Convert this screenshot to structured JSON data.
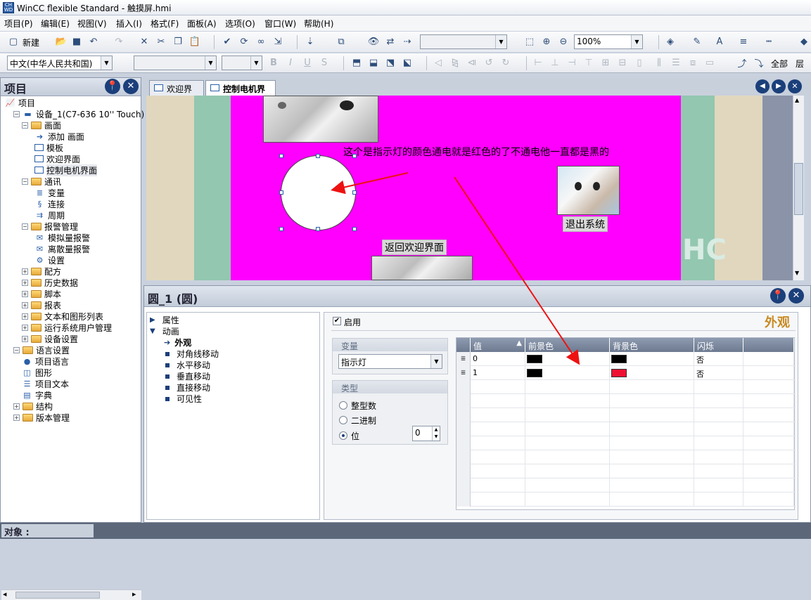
{
  "window": {
    "title": "WinCC flexible Standard - 触摸屏.hmi",
    "app_icon_text": "CH WD"
  },
  "menubar": [
    "项目(P)",
    "编辑(E)",
    "视图(V)",
    "插入(I)",
    "格式(F)",
    "面板(A)",
    "选项(O)",
    "窗口(W)",
    "帮助(H)"
  ],
  "toolbar": {
    "new_label": "新建",
    "zoom_value": "100%",
    "language_value": "中文(中华人民共和国)",
    "all_label": "全部",
    "layer_label": "层"
  },
  "project_panel": {
    "title": "项目",
    "tree": [
      {
        "label": "项目",
        "level": 0,
        "icon": "project-icon"
      },
      {
        "label": "设备_1(C7-636 10'' Touch)",
        "level": 1,
        "icon": "device-icon"
      },
      {
        "label": "画面",
        "level": 2,
        "icon": "folder-icon"
      },
      {
        "label": "添加 画面",
        "level": 3,
        "icon": "add-screen-icon"
      },
      {
        "label": "模板",
        "level": 3,
        "icon": "template-icon"
      },
      {
        "label": "欢迎界面",
        "level": 3,
        "icon": "screen-icon"
      },
      {
        "label": "控制电机界面",
        "level": 3,
        "icon": "screen-icon"
      },
      {
        "label": "通讯",
        "level": 2,
        "icon": "folder-icon"
      },
      {
        "label": "变量",
        "level": 3,
        "icon": "tag-icon"
      },
      {
        "label": "连接",
        "level": 3,
        "icon": "connection-icon"
      },
      {
        "label": "周期",
        "level": 3,
        "icon": "cycle-icon"
      },
      {
        "label": "报警管理",
        "level": 2,
        "icon": "folder-icon"
      },
      {
        "label": "模拟量报警",
        "level": 3,
        "icon": "alarm-icon"
      },
      {
        "label": "离散量报警",
        "level": 3,
        "icon": "alarm-icon"
      },
      {
        "label": "设置",
        "level": 3,
        "icon": "settings-icon"
      },
      {
        "label": "配方",
        "level": 2,
        "icon": "folder-icon"
      },
      {
        "label": "历史数据",
        "level": 2,
        "icon": "folder-icon"
      },
      {
        "label": "脚本",
        "level": 2,
        "icon": "folder-icon"
      },
      {
        "label": "报表",
        "level": 2,
        "icon": "folder-icon"
      },
      {
        "label": "文本和图形列表",
        "level": 2,
        "icon": "folder-icon"
      },
      {
        "label": "运行系统用户管理",
        "level": 2,
        "icon": "folder-icon"
      },
      {
        "label": "设备设置",
        "level": 2,
        "icon": "folder-icon"
      },
      {
        "label": "语言设置",
        "level": 1,
        "icon": "folder-icon"
      },
      {
        "label": "项目语言",
        "level": 2,
        "icon": "globe-icon"
      },
      {
        "label": "图形",
        "level": 2,
        "icon": "graphics-icon"
      },
      {
        "label": "项目文本",
        "level": 2,
        "icon": "text-icon"
      },
      {
        "label": "字典",
        "level": 2,
        "icon": "dictionary-icon"
      },
      {
        "label": "结构",
        "level": 1,
        "icon": "folder-icon"
      },
      {
        "label": "版本管理",
        "level": 1,
        "icon": "folder-icon"
      }
    ]
  },
  "editor": {
    "tabs": [
      {
        "label": "欢迎界面",
        "active": false
      },
      {
        "label": "控制电机界面",
        "active": true
      }
    ],
    "canvas": {
      "annotation_text": "这个是指示灯的颜色通电就是红色的了不通电他一直都是黑的",
      "exit_label": "退出系统",
      "back_label": "返回欢迎界面",
      "background_color": "#ff00ff",
      "side_text": "HC"
    }
  },
  "properties": {
    "title": "圆_1 (圆)",
    "nav": [
      {
        "label": "属性",
        "kind": "collapsed"
      },
      {
        "label": "动画",
        "kind": "expanded"
      },
      {
        "label": "外观",
        "kind": "current"
      },
      {
        "label": "对角线移动",
        "kind": "child"
      },
      {
        "label": "水平移动",
        "kind": "child"
      },
      {
        "label": "垂直移动",
        "kind": "child"
      },
      {
        "label": "直接移动",
        "kind": "child"
      },
      {
        "label": "可见性",
        "kind": "child"
      }
    ],
    "enable_label": "启用",
    "section_title": "外观",
    "variable_group_title": "变量",
    "variable_value": "指示灯",
    "type_group_title": "类型",
    "type_options": [
      {
        "label": "整型数",
        "selected": false
      },
      {
        "label": "二进制",
        "selected": false
      },
      {
        "label": "位",
        "selected": true
      }
    ],
    "bit_value": "0",
    "table": {
      "headers": [
        "值",
        "前景色",
        "背景色",
        "闪烁"
      ],
      "rows": [
        {
          "value": "0",
          "fg": "#000000",
          "bg": "#000000",
          "blink": "否"
        },
        {
          "value": "1",
          "fg": "#000000",
          "bg": "#ee1133",
          "blink": "否"
        }
      ]
    }
  },
  "statusbar": {
    "label": "对象 :"
  },
  "colors": {
    "accent": "#1b3f7a",
    "annotation_arrow": "#ee1111",
    "indicator_red": "#ee1133"
  }
}
